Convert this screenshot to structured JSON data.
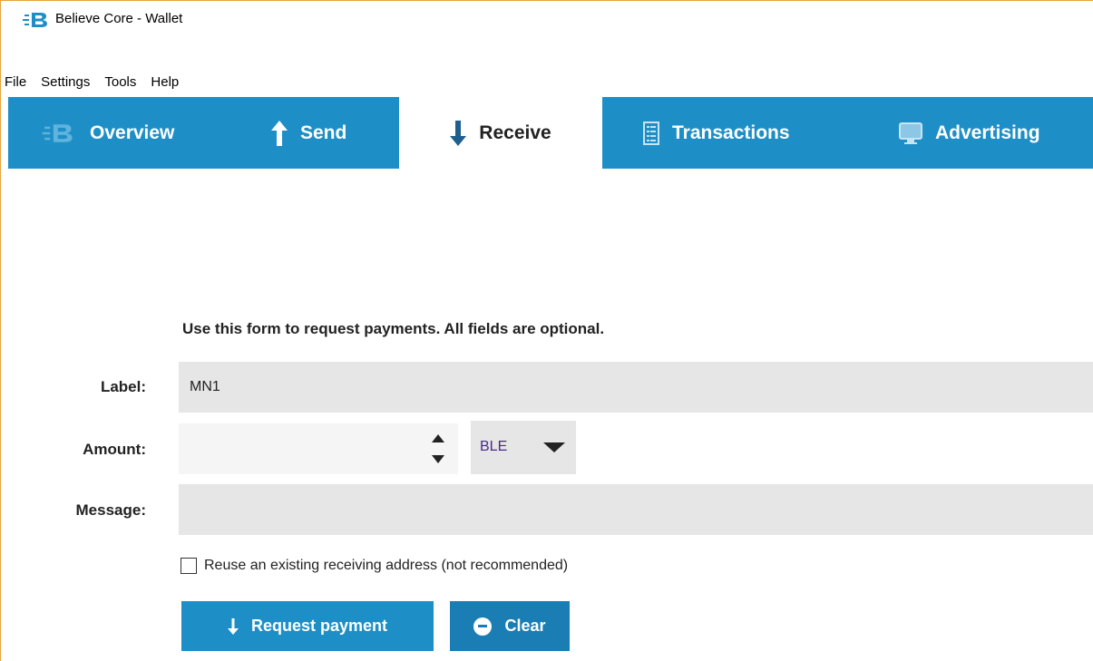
{
  "window": {
    "title": "Believe Core - Wallet"
  },
  "menu": {
    "items": [
      "File",
      "Settings",
      "Tools",
      "Help"
    ]
  },
  "tabs": [
    {
      "label": "Overview",
      "icon": "believe-logo-icon",
      "active": false
    },
    {
      "label": "Send",
      "icon": "arrow-up-icon",
      "active": false
    },
    {
      "label": "Receive",
      "icon": "arrow-down-icon",
      "active": true
    },
    {
      "label": "Transactions",
      "icon": "list-icon",
      "active": false
    },
    {
      "label": "Advertising",
      "icon": "monitor-icon",
      "active": false
    }
  ],
  "form": {
    "instructions": "Use this form to request payments. All fields are optional.",
    "label_caption": "Label:",
    "label_value": "MN1",
    "amount_caption": "Amount:",
    "amount_value": "",
    "unit": "BLE",
    "message_caption": "Message:",
    "message_value": "",
    "reuse_address_label": "Reuse an existing receiving address (not recommended)",
    "reuse_address_checked": false
  },
  "buttons": {
    "request_payment": "Request payment",
    "clear": "Clear"
  },
  "colors": {
    "accent": "#1e8fc6",
    "window_border": "#e8a23a",
    "field_bg": "#e6e6e6",
    "unit_text": "#4a2a8a"
  }
}
